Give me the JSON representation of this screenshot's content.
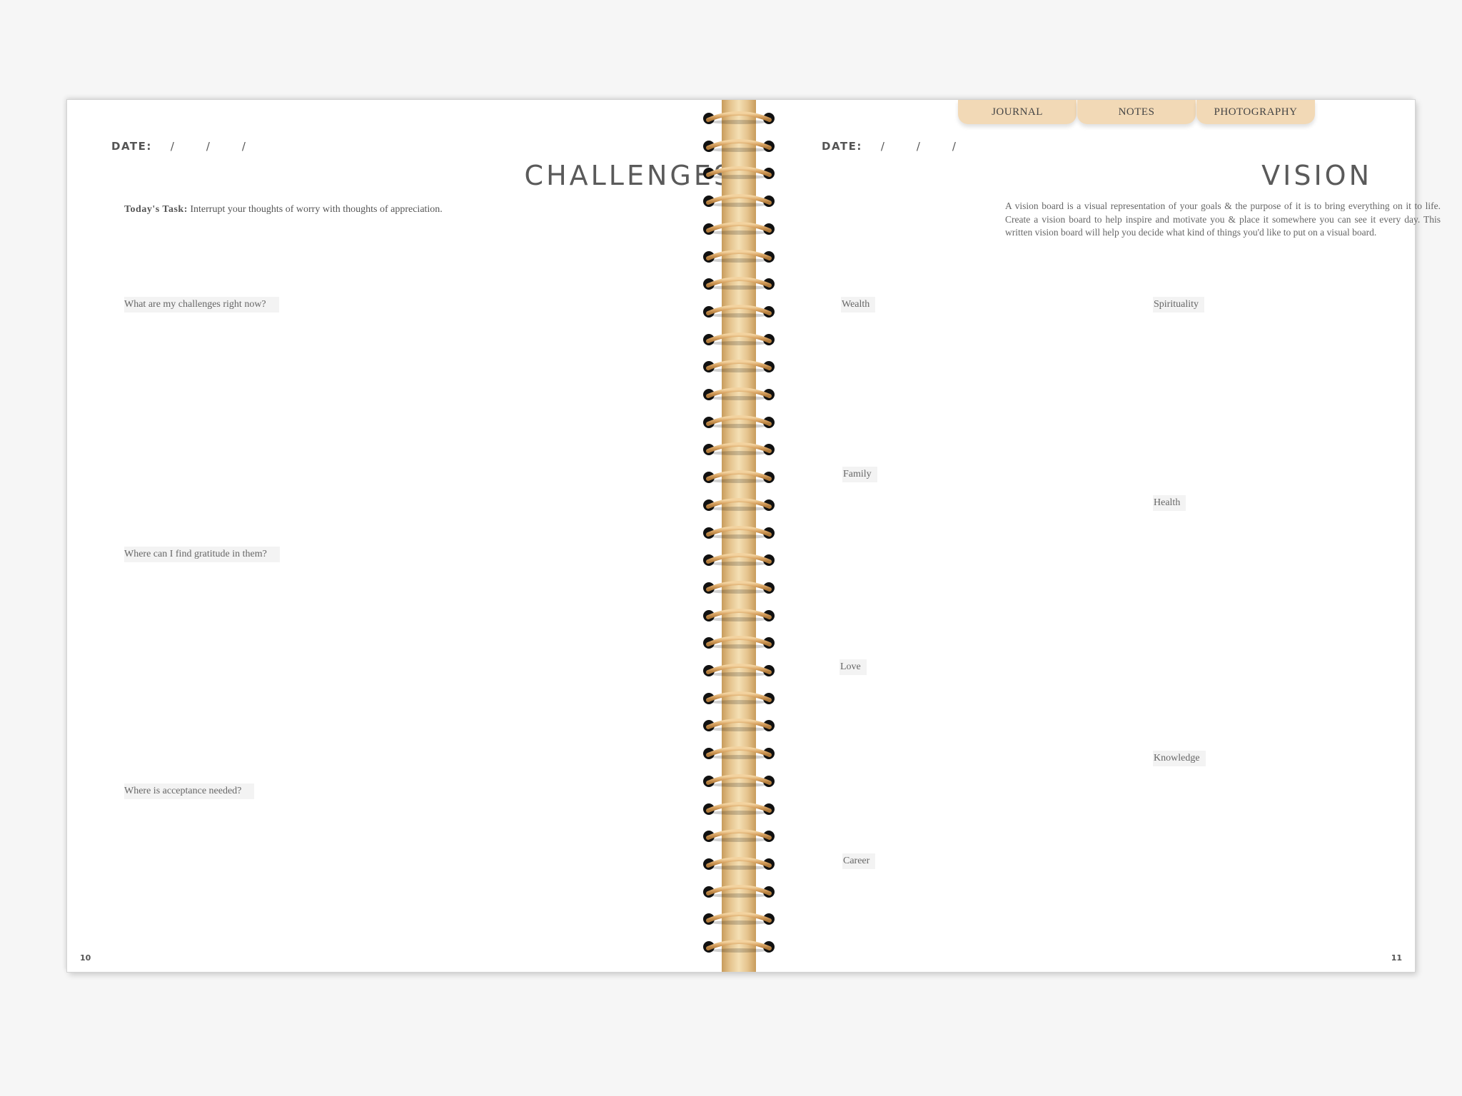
{
  "left_page": {
    "date_label": "DATE:",
    "date_separators": [
      "/",
      "/",
      "/"
    ],
    "title": "CHALLENGES",
    "task_label": "Today's Task:",
    "task_text": " Interrupt your thoughts of worry with thoughts of appreciation.",
    "prompts": [
      "What are my challenges right now?",
      "Where can I find gratitude in them?",
      "Where is acceptance needed?"
    ],
    "page_number": "10"
  },
  "right_page": {
    "date_label": "DATE:",
    "date_separators": [
      "/",
      "/",
      "/"
    ],
    "title": "VISION",
    "intro": "A vision board is a visual representation of your goals & the purpose of it is to bring everything on it to life. Create a vision board to help inspire and motivate you & place it somewhere you can see it every day. This written vision board will help you decide what kind of things you'd like to put on a visual board.",
    "categories": [
      "Wealth",
      "Spirituality",
      "Family",
      "Health",
      "Love",
      "Knowledge",
      "Career"
    ],
    "page_number": "11"
  },
  "tabs": [
    {
      "label": "JOURNAL"
    },
    {
      "label": "NOTES"
    },
    {
      "label": "PHOTOGRAPHY"
    }
  ],
  "colors": {
    "tab_fill": "#f2d9b6",
    "spine_gold": "#e5c48e",
    "ring_hole": "#111111"
  },
  "spine": {
    "ring_count": 31
  }
}
